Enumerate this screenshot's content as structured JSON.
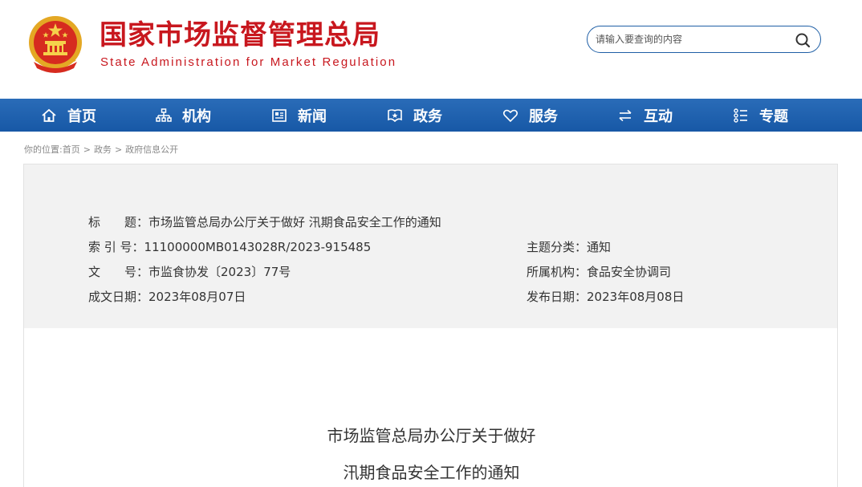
{
  "header": {
    "title_cn": "国家市场监督管理总局",
    "title_en": "State Administration for Market Regulation",
    "emblem_icon": "national-emblem-icon",
    "brand_color": "#c8171e"
  },
  "search": {
    "placeholder": "请输入要查询的内容",
    "icon": "search-icon"
  },
  "nav": {
    "color": "#1f63b0",
    "items": [
      {
        "label": "首页",
        "icon": "home-icon"
      },
      {
        "label": "机构",
        "icon": "org-chart-icon"
      },
      {
        "label": "新闻",
        "icon": "newspaper-icon"
      },
      {
        "label": "政务",
        "icon": "badge-icon"
      },
      {
        "label": "服务",
        "icon": "heart-icon"
      },
      {
        "label": "互动",
        "icon": "exchange-arrows-icon"
      },
      {
        "label": "专题",
        "icon": "list-icon"
      }
    ]
  },
  "breadcrumb": {
    "prefix": "你的位置:",
    "items": [
      "首页",
      "政务",
      "政府信息公开"
    ],
    "separator": ">"
  },
  "info": {
    "title_key": "标　　题：",
    "title_value": "市场监管总局办公厅关于做好 汛期食品安全工作的通知",
    "index_key": "索 引 号：",
    "index_value": "11100000MB0143028R/2023-915485",
    "topic_key": "主题分类：",
    "topic_value": "通知",
    "docno_key": "文　　号：",
    "docno_value": "市监食协发〔2023〕77号",
    "org_key": "所属机构：",
    "org_value": "食品安全协调司",
    "date_key": "成文日期：",
    "date_value": "2023年08月07日",
    "pub_key": "发布日期：",
    "pub_value": "2023年08月08日"
  },
  "document": {
    "title_line1": "市场监管总局办公厅关于做好",
    "title_line2": "汛期食品安全工作的通知"
  }
}
